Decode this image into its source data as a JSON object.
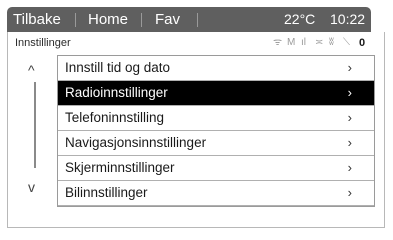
{
  "topbar": {
    "tabs": [
      "Tilbake",
      "Home",
      "Fav"
    ],
    "temperature": "22°C",
    "time": "10:22"
  },
  "page_title": "Innstillinger",
  "status_icons": [
    "wifi-icon",
    "message-icon",
    "signal-icon",
    "signal-off-icon",
    "bluetooth-icon",
    "phone-icon",
    "battery-icon"
  ],
  "status_icon_glyphs": [
    "ᯤ",
    "M",
    "ıl",
    "≍",
    "ʬ",
    "⟍",
    "0"
  ],
  "menu": {
    "arrow": "›",
    "items": [
      "Innstill tid og dato",
      "Radioinnstillinger",
      "Telefoninnstilling",
      "Navigasjonsinnstillinger",
      "Skjerminnstillinger",
      "Bilinnstillinger"
    ],
    "selected_index": 1
  },
  "scroll": {
    "up": "^",
    "down": "v"
  },
  "colors": {
    "topbar": "#5f5f5f",
    "selected_row": "#000000"
  }
}
